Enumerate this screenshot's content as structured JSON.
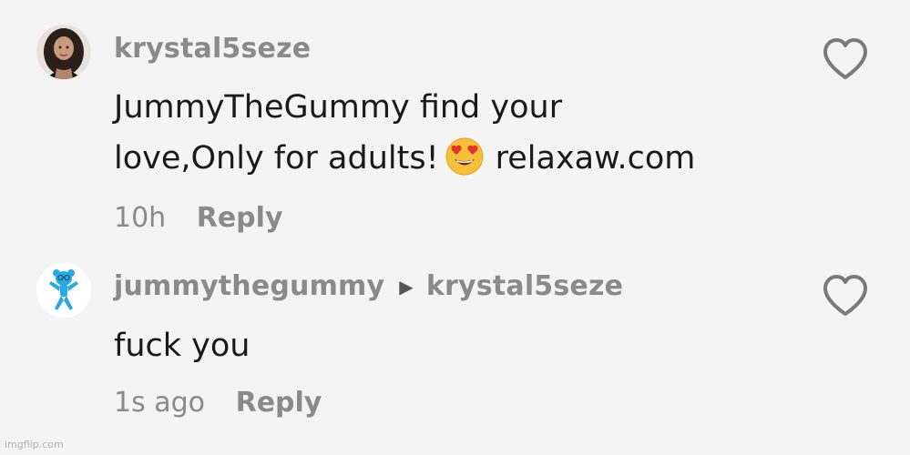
{
  "comments": [
    {
      "username": "krystal5seze",
      "text_line1": "JummyTheGummy find your",
      "text_line2_before_emoji": "love,Only for adults!",
      "emoji": "heart-eyes-emoji",
      "text_line2_after_emoji": "relaxaw.com",
      "time": "10h",
      "reply_label": "Reply"
    },
    {
      "username": "jummythegummy",
      "reply_to": "krystal5seze",
      "text": "fuck you",
      "time": "1s ago",
      "reply_label": "Reply"
    }
  ],
  "watermark": "imgflip.com",
  "colors": {
    "background": "#f4f4f4",
    "muted_text": "#8a8a8a",
    "body_text": "#1a1a1a",
    "icon_gray": "#7a7a7a",
    "avatar_accent": "#29a9e1"
  }
}
